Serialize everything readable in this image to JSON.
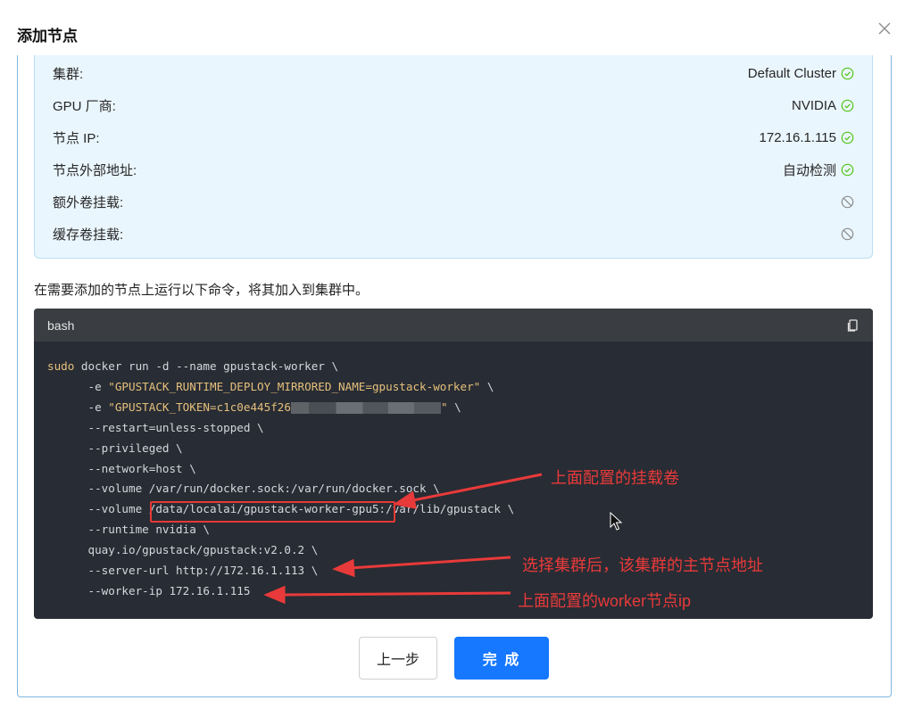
{
  "modal": {
    "title": "添加节点",
    "close_icon": "close-icon"
  },
  "summary": {
    "rows": [
      {
        "label": "集群:",
        "value": "Default Cluster",
        "status": "check-circle-icon"
      },
      {
        "label": "GPU 厂商:",
        "value": "NVIDIA",
        "status": "check-circle-icon"
      },
      {
        "label": "节点 IP:",
        "value": "172.16.1.115",
        "status": "check-circle-icon"
      },
      {
        "label": "节点外部地址:",
        "value": "自动检测",
        "status": "check-circle-icon"
      },
      {
        "label": "额外卷挂载:",
        "value": "",
        "status": "disabled-icon"
      },
      {
        "label": "缓存卷挂载:",
        "value": "",
        "status": "disabled-icon"
      }
    ]
  },
  "instruction": "在需要添加的节点上运行以下命令，将其加入到集群中。",
  "code": {
    "language": "bash",
    "copy_icon": "copy-icon",
    "lines": {
      "l1_kw": "sudo",
      "l1_rest": " docker run -d --name gpustack-worker \\",
      "l2_pre": "      -e ",
      "l2_str": "\"GPUSTACK_RUNTIME_DEPLOY_MIRRORED_NAME=gpustack-worker\"",
      "l2_post": " \\",
      "l3_pre": "      -e ",
      "l3_str_a": "\"GPUSTACK_TOKEN=c1c0e445f26",
      "l3_str_b": "\"",
      "l3_post": " \\",
      "l4": "      --restart=unless-stopped \\",
      "l5": "      --privileged \\",
      "l6": "      --network=host \\",
      "l7": "      --volume /var/run/docker.sock:/var/run/docker.sock \\",
      "l8_pre": "      --volume ",
      "l8_path": "/data/localai/gpustack-worker-gpu5",
      "l8_post": ":/var/lib/gpustack \\",
      "l9": "      --runtime nvidia \\",
      "l10": "      quay.io/gpustack/gpustack:v2.0.2 \\",
      "l11": "      --server-url http://172.16.1.113 \\",
      "l12": "      --worker-ip 172.16.1.115"
    }
  },
  "annotations": {
    "volume": "上面配置的挂载卷",
    "server": "选择集群后，该集群的主节点地址",
    "worker": "上面配置的worker节点ip"
  },
  "colors": {
    "primary": "#1677ff",
    "success": "#52c41a",
    "annotation": "#e83a3a",
    "code_bg": "#282c34"
  },
  "buttons": {
    "prev": "上一步",
    "done": "完 成"
  }
}
